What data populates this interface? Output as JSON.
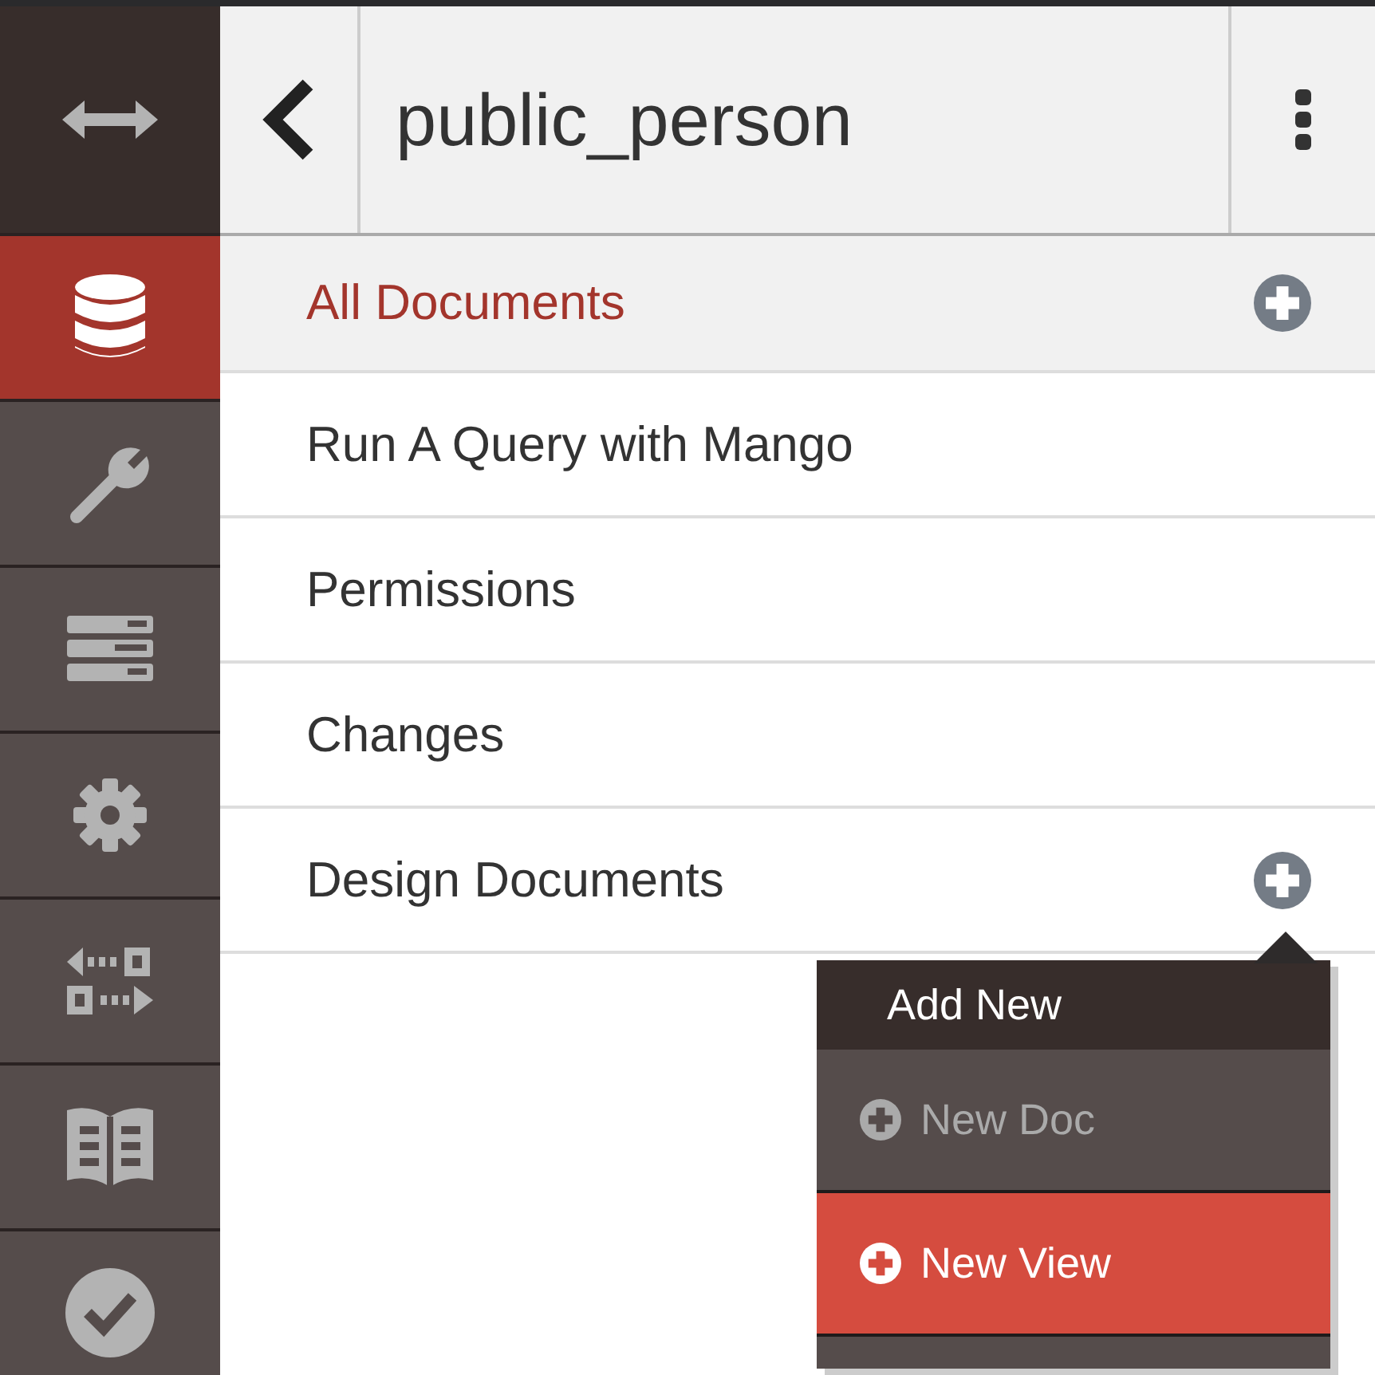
{
  "sidebar": {
    "items": [
      {
        "kind": "toggle",
        "selected": false
      },
      {
        "kind": "database",
        "selected": true
      },
      {
        "kind": "wrench",
        "selected": false
      },
      {
        "kind": "list",
        "selected": false
      },
      {
        "kind": "gear",
        "selected": false
      },
      {
        "kind": "replicate",
        "selected": false
      },
      {
        "kind": "book",
        "selected": false
      },
      {
        "kind": "check",
        "selected": false
      }
    ]
  },
  "header": {
    "title": "public_person"
  },
  "nav": [
    {
      "label": "All Documents",
      "selected": true,
      "add": true
    },
    {
      "label": "Run A Query with Mango",
      "selected": false,
      "add": false
    },
    {
      "label": "Permissions",
      "selected": false,
      "add": false
    },
    {
      "label": "Changes",
      "selected": false,
      "add": false
    },
    {
      "label": "Design Documents",
      "selected": false,
      "add": true
    }
  ],
  "add_menu": {
    "title": "Add New",
    "items": [
      {
        "label": "New Doc",
        "selected": false
      },
      {
        "label": "New View",
        "selected": true
      }
    ]
  }
}
